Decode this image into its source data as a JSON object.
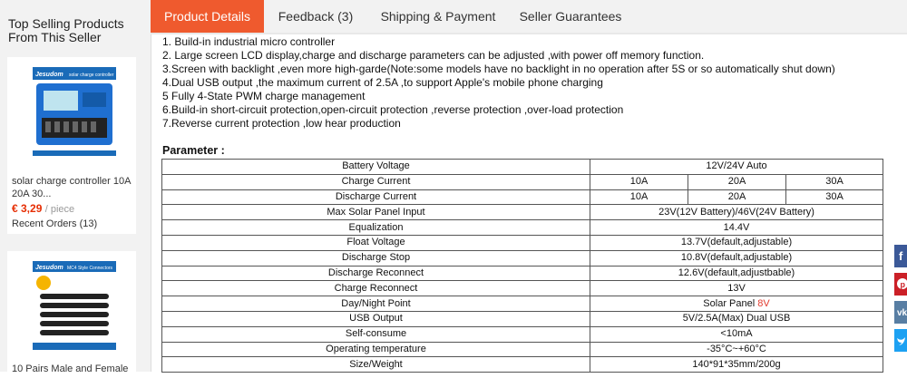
{
  "sidebar": {
    "title": "Top Selling Products From This Seller",
    "products": [
      {
        "thumb_brand": "Jesudom",
        "thumb_caption": "solar charge controller",
        "name": "solar charge controller 10A 20A 30...",
        "price": "€ 3,29",
        "unit": "/ piece",
        "orders": "Recent Orders (13)"
      },
      {
        "thumb_brand": "Jesudom",
        "thumb_caption": "MC4 Style Connectors",
        "name": "10 Pairs Male and Female",
        "price": "",
        "unit": "",
        "orders": ""
      }
    ]
  },
  "tabs": [
    "Product Details",
    "Feedback (3)",
    "Shipping & Payment",
    "Seller Guarantees"
  ],
  "active_tab": 0,
  "features": [
    "1. Build-in industrial micro controller",
    "2. Large screen LCD display,charge and discharge parameters can be adjusted ,with power off memory function.",
    "3.Screen with backlight ,even more high-garde(Note:some models have no backlight in no operation after 5S or so automatically shut down)",
    "4.Dual USB output ,the maximum current of 2.5A ,to support Apple's mobile phone charging",
    "5 Fully 4-State PWM charge management",
    "6.Build-in short-circuit protection,open-circuit protection ,reverse protection ,over-load protection",
    "7.Reverse current protection ,low hear production"
  ],
  "parameter_title": "Parameter :",
  "params": [
    {
      "label": "Battery Voltage",
      "value": "12V/24V Auto"
    },
    {
      "label": "Charge Current",
      "cells": [
        "10A",
        "20A",
        "30A"
      ]
    },
    {
      "label": "Discharge Current",
      "cells": [
        "10A",
        "20A",
        "30A"
      ]
    },
    {
      "label": "Max Solar Panel Input",
      "value": "23V(12V Battery)/46V(24V Battery)"
    },
    {
      "label": "Equalization",
      "value": "14.4V",
      "red": true
    },
    {
      "label": "Float Voltage",
      "value": "13.7V(default,adjustable)",
      "red": true
    },
    {
      "label": "Discharge Stop",
      "value": "10.8V(default,adjustable)",
      "red": true
    },
    {
      "label": "Discharge Reconnect",
      "value": "12.6V(default,adjustbable)",
      "red": true
    },
    {
      "label": "Charge Reconnect",
      "value": "13V",
      "red": true
    },
    {
      "label": "Day/Night Point",
      "value": "Solar Panel ",
      "value_red": "8V"
    },
    {
      "label": "USB Output",
      "value": "5V/2.5A(Max) Dual USB"
    },
    {
      "label": "Self-consume",
      "value": "<10mA"
    },
    {
      "label": "Operating temperature",
      "value": "-35°C~+60°C"
    },
    {
      "label": "Size/Weight",
      "value": "140*91*35mm/200g"
    }
  ],
  "social": [
    {
      "icon": "facebook-icon",
      "color": "#3b5998"
    },
    {
      "icon": "pinterest-icon",
      "color": "#cb2027"
    },
    {
      "icon": "vk-icon",
      "color": "#587ea3"
    },
    {
      "icon": "twitter-icon",
      "color": "#1da1f2"
    }
  ]
}
